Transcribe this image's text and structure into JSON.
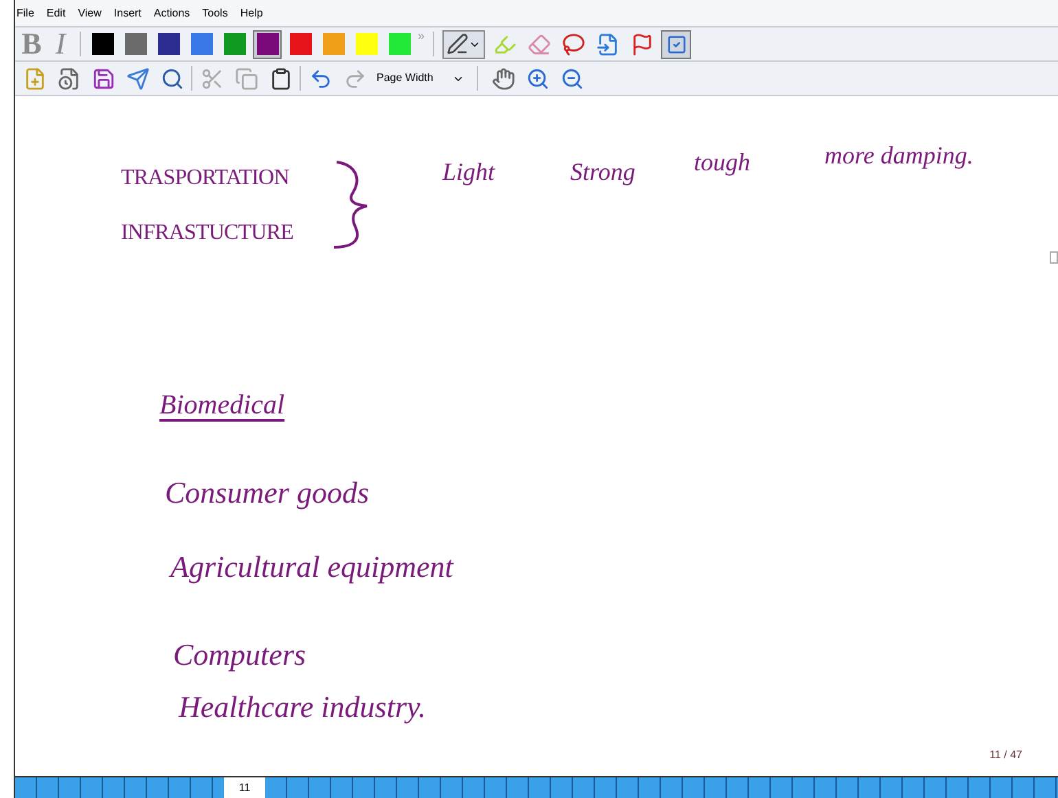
{
  "menu": [
    "File",
    "Edit",
    "View",
    "Insert",
    "Actions",
    "Tools",
    "Help"
  ],
  "format_buttons": [
    {
      "label": "B",
      "kind": "bold"
    },
    {
      "label": "I",
      "kind": "italic"
    }
  ],
  "palette": [
    {
      "color": "#000000",
      "selected": false
    },
    {
      "color": "#6b6b6b",
      "selected": false
    },
    {
      "color": "#2b2b90",
      "selected": false
    },
    {
      "color": "#3a78e8",
      "selected": false
    },
    {
      "color": "#119a22",
      "selected": false
    },
    {
      "color": "#7a0a7a",
      "selected": true
    },
    {
      "color": "#e8141c",
      "selected": false
    },
    {
      "color": "#f0a018",
      "selected": false
    },
    {
      "color": "#ffff10",
      "selected": false
    },
    {
      "color": "#22e838",
      "selected": false
    }
  ],
  "overflow": "»",
  "zoom_select": {
    "value": "Page Width"
  },
  "note": {
    "lines": [
      {
        "text": "TRASPORTATION",
        "kind": "caps"
      },
      {
        "text": "INFRASTUCTURE",
        "kind": "caps"
      },
      {
        "text": "Light",
        "kind": "small"
      },
      {
        "text": "Strong",
        "kind": "small"
      },
      {
        "text": "tough",
        "kind": "small"
      },
      {
        "text": "more damping.",
        "kind": "small"
      },
      {
        "text": "Biomedical",
        "kind": "underlined"
      },
      {
        "text": "Consumer goods",
        "kind": "script"
      },
      {
        "text": "Agricultural equipment",
        "kind": "script"
      },
      {
        "text": "Computers",
        "kind": "script"
      },
      {
        "text": "Healthcare industry.",
        "kind": "script"
      }
    ]
  },
  "page_indicator": "11 / 47",
  "page_strip": {
    "current": "11"
  }
}
